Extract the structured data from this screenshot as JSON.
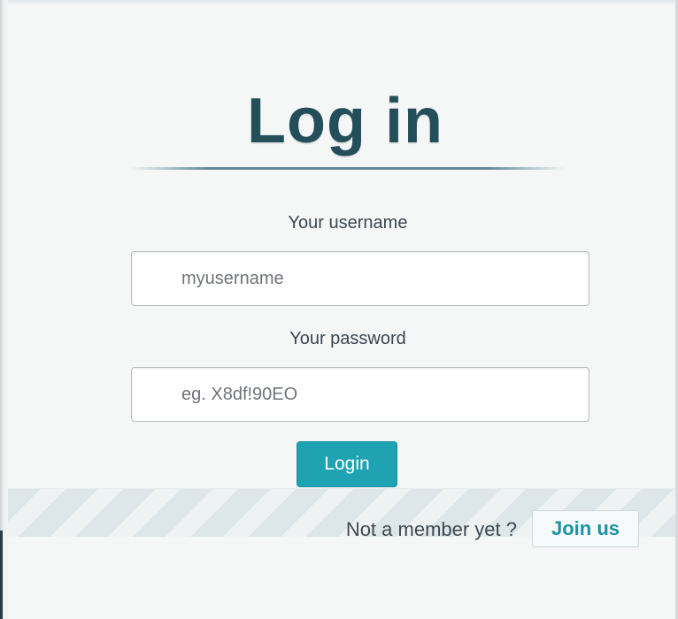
{
  "header": {
    "title": "Log in"
  },
  "form": {
    "username_label": "Your username",
    "username_placeholder": "myusername",
    "password_label": "Your password",
    "password_placeholder": "eg. X8df!90EO",
    "submit_label": "Login"
  },
  "footer": {
    "prompt": "Not a member yet ?",
    "join_label": "Join us"
  },
  "colors": {
    "accent": "#1fa3b2",
    "title": "#234f5b",
    "link": "#1b93a3",
    "background": "#f5f6f6"
  }
}
